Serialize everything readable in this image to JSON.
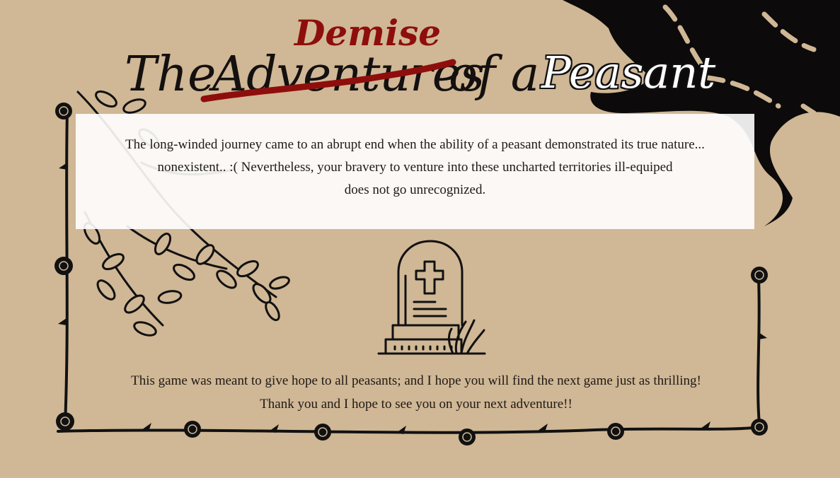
{
  "screen": "ending-demise",
  "title": {
    "word_the": "The",
    "word_adventures_struck": "Adventures",
    "word_demise": "Demise",
    "word_of_a": "of a",
    "word_peasant": "Peasant"
  },
  "story": {
    "line1": "The long-winded journey came to an abrupt end when the ability of a peasant demonstrated its true nature...",
    "line2": "nonexistent.. :( Nevertheless, your bravery to venture into these uncharted territories ill-equiped",
    "line3": "does not go unrecognized."
  },
  "closing": {
    "line1": "This game was meant to give hope to all peasants; and I hope you will find the next game just as thrilling!",
    "line2": "Thank you and I hope to see you on your next adventure!!"
  },
  "icons": {
    "tombstone": "gravestone-cross-icon",
    "bat_wing": "bat-wing-icon",
    "leaves": "leafy-branch-icon",
    "roses": "rose-icon",
    "thorn_border": "thorn-vine-border"
  },
  "colors": {
    "background": "#d0b795",
    "demise_red": "#8e0e0c",
    "ink": "#141010",
    "panel": "#ffffff"
  }
}
